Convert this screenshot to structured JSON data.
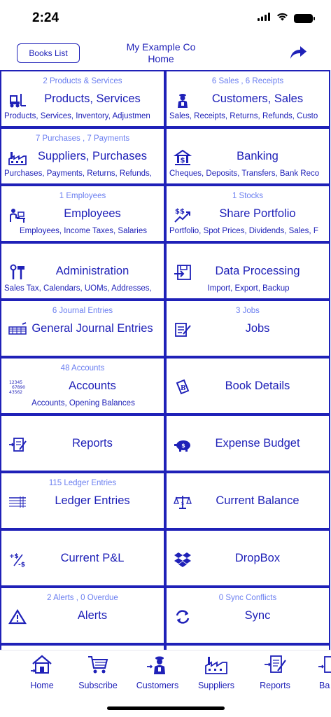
{
  "status_bar": {
    "time": "2:24"
  },
  "nav": {
    "books_list_label": "Books List",
    "company": "My Example Co",
    "page": "Home"
  },
  "tiles": [
    {
      "sub": "2 Products & Services",
      "title": "Products, Services",
      "desc": "Products, Services, Inventory, Adjustmen",
      "icon": "forklift-icon"
    },
    {
      "sub": "6 Sales , 6 Receipts",
      "title": "Customers, Sales",
      "desc": "Sales, Receipts, Returns, Refunds, Custo",
      "icon": "customer-icon"
    },
    {
      "sub": "7 Purchases , 7 Payments",
      "title": "Suppliers, Purchases",
      "desc": "Purchases, Payments, Returns, Refunds,",
      "icon": "factory-icon"
    },
    {
      "sub": "",
      "title": "Banking",
      "desc": "Cheques, Deposits, Transfers, Bank Reco",
      "icon": "bank-icon"
    },
    {
      "sub": "1 Employees",
      "title": "Employees",
      "desc": "Employees, Income Taxes, Salaries",
      "icon": "employee-desk-icon"
    },
    {
      "sub": "1 Stocks",
      "title": "Share Portfolio",
      "desc": "Portfolio, Spot Prices, Dividends, Sales, F",
      "icon": "stock-chart-icon"
    },
    {
      "sub": "",
      "title": "Administration",
      "desc": "Sales Tax, Calendars, UOMs, Addresses,",
      "icon": "tools-icon"
    },
    {
      "sub": "",
      "title": "Data Processing",
      "desc": "Import, Export, Backup",
      "icon": "disk-import-icon"
    },
    {
      "sub": "6 Journal Entries",
      "title": "General Journal Entries",
      "desc": "",
      "icon": "journal-ledger-icon"
    },
    {
      "sub": "3 Jobs",
      "title": "Jobs",
      "desc": "",
      "icon": "job-list-icon"
    },
    {
      "sub": "48 Accounts",
      "title": "Accounts",
      "desc": "Accounts, Opening Balances",
      "icon": "account-numbers-icon",
      "icon_text": [
        "12345",
        "67890",
        "43562"
      ]
    },
    {
      "sub": "",
      "title": "Book Details",
      "desc": "",
      "icon": "book-icon"
    },
    {
      "sub": "",
      "title": "Reports",
      "desc": "",
      "icon": "report-icon"
    },
    {
      "sub": "",
      "title": "Expense Budget",
      "desc": "",
      "icon": "piggy-bank-icon"
    },
    {
      "sub": "115 Ledger Entries",
      "title": "Ledger Entries",
      "desc": "",
      "icon": "ledger-icon"
    },
    {
      "sub": "",
      "title": "Current Balance",
      "desc": "",
      "icon": "scale-icon"
    },
    {
      "sub": "",
      "title": "Current P&L",
      "desc": "",
      "icon": "profit-loss-icon"
    },
    {
      "sub": "",
      "title": "DropBox",
      "desc": "",
      "icon": "dropbox-icon"
    },
    {
      "sub": "2 Alerts , 0 Overdue",
      "title": "Alerts",
      "desc": "",
      "icon": "alert-triangle-icon"
    },
    {
      "sub": "0 Sync Conflicts",
      "title": "Sync",
      "desc": "",
      "icon": "sync-icon"
    }
  ],
  "tabs": [
    {
      "label": "Home",
      "icon": "home-icon"
    },
    {
      "label": "Subscribe",
      "icon": "cart-icon"
    },
    {
      "label": "Customers",
      "icon": "customer-icon"
    },
    {
      "label": "Suppliers",
      "icon": "factory-icon"
    },
    {
      "label": "Reports",
      "icon": "report-icon"
    },
    {
      "label": "Ba",
      "icon": "bank-icon"
    }
  ],
  "colors": {
    "primary": "#1f21b8",
    "subtle": "#6a7ef0",
    "background": "#ffffff"
  }
}
